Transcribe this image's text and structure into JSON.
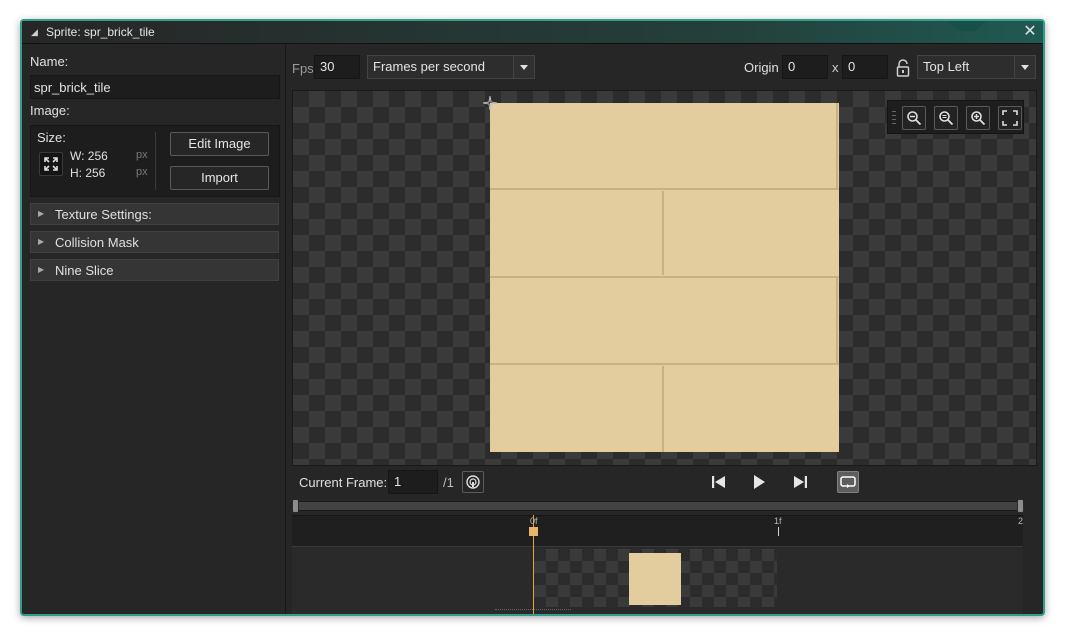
{
  "window": {
    "title": "Sprite: spr_brick_tile",
    "collapse_icon": "collapse-triangle-icon",
    "close_icon": "close-icon",
    "accent_color": "#2f9e8a"
  },
  "left_panel": {
    "name_label": "Name:",
    "name_value": "spr_brick_tile",
    "image_label": "Image:",
    "size_label": "Size:",
    "width_text": "W: 256",
    "height_text": "H: 256",
    "px_unit": "px",
    "edit_image_label": "Edit Image",
    "import_label": "Import",
    "sections": [
      {
        "label": "Texture Settings:"
      },
      {
        "label": "Collision Mask"
      },
      {
        "label": "Nine Slice"
      }
    ]
  },
  "toolbar": {
    "fps_label": "Fps",
    "fps_value": "30",
    "fps_mode": "Frames per second",
    "origin_label": "Origin",
    "origin_x": "0",
    "x_label": "x",
    "origin_y": "0",
    "origin_preset": "Top Left"
  },
  "canvas": {
    "sprite_color": "#e3cc9e",
    "mortar_color": "#c9b184",
    "zoom_buttons": [
      "zoom-out-icon",
      "zoom-reset-icon",
      "zoom-in-icon",
      "fit-to-view-icon"
    ]
  },
  "playback": {
    "current_frame_label": "Current Frame:",
    "current_frame_value": "1",
    "frame_total": "/1",
    "buttons": [
      "onion-skin-icon",
      "first-frame-icon",
      "play-icon",
      "last-frame-icon",
      "loop-icon"
    ]
  },
  "timeline": {
    "ticks": [
      "0f",
      "1f",
      "2"
    ],
    "playhead_color": "#e8a33a"
  }
}
